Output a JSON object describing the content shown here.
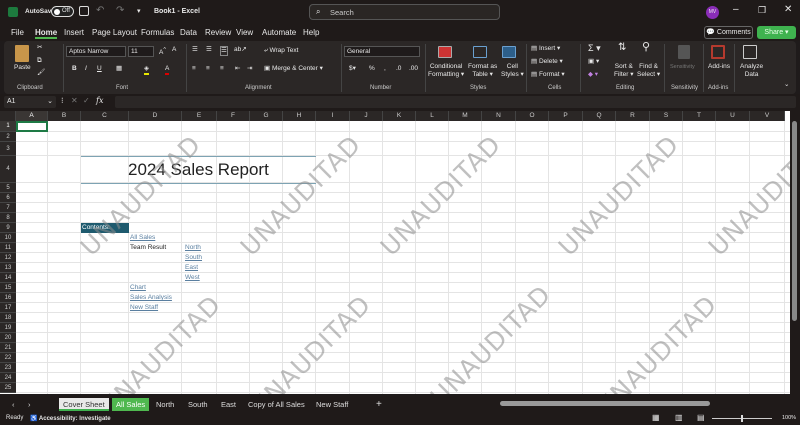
{
  "titlebar": {
    "autosave": "AutoSave",
    "toggle": "Off",
    "doc_title": "Book1 - Excel",
    "search_placeholder": "Search",
    "avatar": "MV"
  },
  "menu": [
    "File",
    "Home",
    "Insert",
    "Page Layout",
    "Formulas",
    "Data",
    "Review",
    "View",
    "Automate",
    "Help"
  ],
  "comments": "Comments",
  "share": "Share",
  "ribbon": {
    "paste": "Paste",
    "font_name": "Aptos Narrow",
    "font_size": "11",
    "wrap_text": "Wrap Text",
    "merge_center": "Merge & Center",
    "number_format": "General",
    "conditional": "Conditional",
    "formatting": "Formatting",
    "format_as": "Format as",
    "table": "Table",
    "cell": "Cell",
    "styles_btn": "Styles",
    "insert": "Insert",
    "delete": "Delete",
    "format": "Format",
    "sort": "Sort &",
    "filter": "Filter",
    "find": "Find &",
    "select": "Select",
    "sensitivity_btn": "Sensitivity",
    "addins_btn": "Add-ins",
    "analyze": "Analyze",
    "data": "Data",
    "groups": {
      "clipboard": "Clipboard",
      "font": "Font",
      "alignment": "Alignment",
      "number": "Number",
      "styles": "Styles",
      "cells": "Cells",
      "editing": "Editing",
      "sensitivity": "Sensitivity",
      "addins": "Add-ins"
    }
  },
  "formula": {
    "name_box": "A1",
    "fx": "fx",
    "value": ""
  },
  "columns": [
    "A",
    "B",
    "C",
    "D",
    "E",
    "F",
    "G",
    "H",
    "I",
    "J",
    "K",
    "L",
    "M",
    "N",
    "O",
    "P",
    "Q",
    "R",
    "S",
    "T",
    "U",
    "V"
  ],
  "rows": [
    "1",
    "2",
    "3",
    "4",
    "5",
    "6",
    "7",
    "8",
    "9",
    "10",
    "11",
    "12",
    "13",
    "14",
    "15",
    "16",
    "17",
    "18",
    "19",
    "20",
    "21",
    "22",
    "23",
    "24",
    "25"
  ],
  "cells": {
    "title": "2024 Sales Report",
    "contents": "Contents:",
    "all_sales": "All Sales",
    "team_result": "Team Result",
    "north": "North",
    "south": "South",
    "east": "East",
    "west": "West",
    "chart": "Chart",
    "sales_analysis": "Sales Analysis",
    "new_staff": "New Staff"
  },
  "watermark": "UNAUDITAD",
  "sheet_tabs": [
    "Cover Sheet",
    "All Sales",
    "North",
    "South",
    "East",
    "Copy of All Sales",
    "New Staff"
  ],
  "active_tab": "All Sales",
  "status": {
    "ready": "Ready",
    "accessibility": "Accessibility: Investigate",
    "zoom": "100%"
  },
  "colors": {
    "accent": "#4fb84f",
    "header_fill": "#1e5a6e",
    "share": "#3fb24f"
  }
}
